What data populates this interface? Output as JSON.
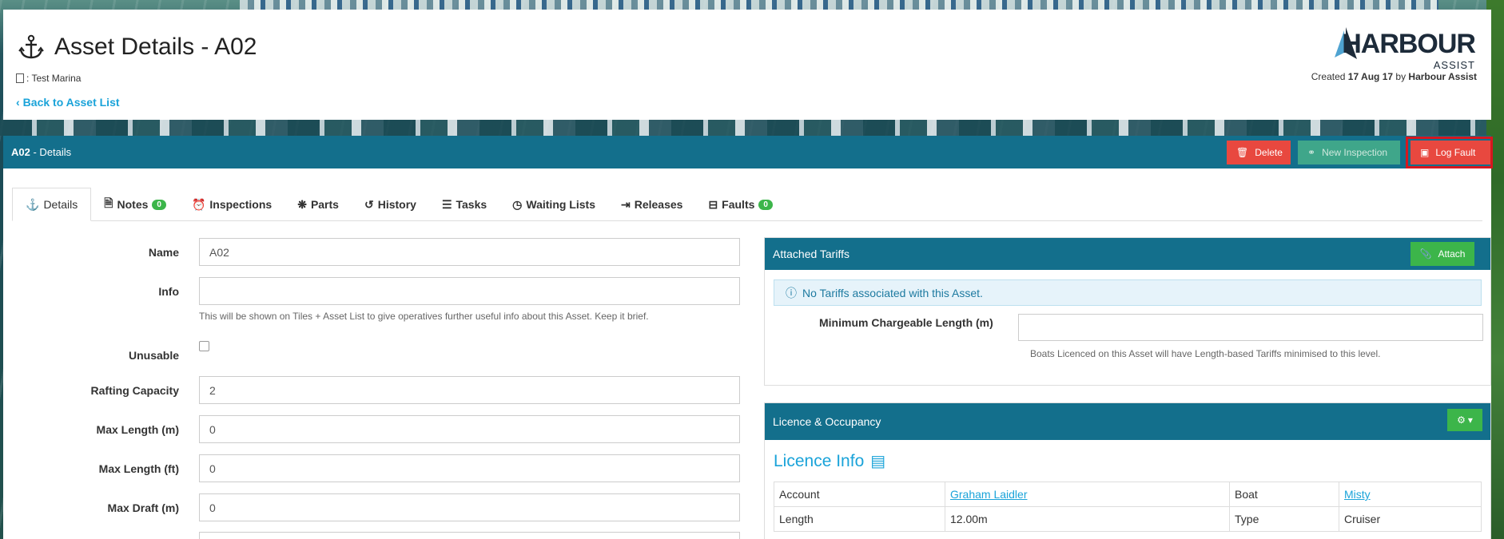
{
  "header": {
    "title": "Asset Details - A02",
    "marina": ": Test Marina",
    "back_link": "Back to Asset List",
    "logo_main": "HARBOUR",
    "logo_sub": "ASSIST",
    "created_prefix": "Created",
    "created_date": "17 Aug 17",
    "created_by_prefix": "by",
    "created_by": "Harbour Assist"
  },
  "bar": {
    "asset_code": "A02",
    "suffix": "- Details",
    "delete_label": "Delete",
    "new_inspection_label": "New Inspection",
    "log_fault_label": "Log Fault"
  },
  "tabs": [
    {
      "label": "Details",
      "icon": "anchor-icon"
    },
    {
      "label": "Notes",
      "icon": "document-icon",
      "badge": "0"
    },
    {
      "label": "Inspections",
      "icon": "alarm-clock-icon"
    },
    {
      "label": "Parts",
      "icon": "puzzle-icon"
    },
    {
      "label": "History",
      "icon": "history-icon"
    },
    {
      "label": "Tasks",
      "icon": "task-list-icon"
    },
    {
      "label": "Waiting Lists",
      "icon": "clock-icon"
    },
    {
      "label": "Releases",
      "icon": "sign-out-icon"
    },
    {
      "label": "Faults",
      "icon": "toolbox-icon",
      "badge": "0"
    }
  ],
  "form": {
    "name_label": "Name",
    "name_value": "A02",
    "info_label": "Info",
    "info_value": "",
    "info_help": "This will be shown on Tiles + Asset List to give operatives further useful info about this Asset. Keep it brief.",
    "unusable_label": "Unusable",
    "rafting_label": "Rafting Capacity",
    "rafting_value": "2",
    "max_length_m_label": "Max Length (m)",
    "max_length_m_value": "0",
    "max_length_ft_label": "Max Length (ft)",
    "max_length_ft_value": "0",
    "max_draft_label": "Max Draft (m)",
    "max_draft_value": "0"
  },
  "tariffs": {
    "title": "Attached Tariffs",
    "attach_label": "Attach",
    "no_tariffs": "No Tariffs associated with this Asset.",
    "min_length_label": "Minimum Chargeable Length (m)",
    "min_length_value": "",
    "min_length_help": "Boats Licenced on this Asset will have Length-based Tariffs minimised to this level."
  },
  "licence": {
    "title": "Licence & Occupancy",
    "info_title": "Licence Info",
    "rows": [
      {
        "k1": "Account",
        "v1": "Graham Laidler",
        "k2": "Boat",
        "v2": "Misty"
      },
      {
        "k1": "Length",
        "v1": "12.00m",
        "k2": "Type",
        "v2": "Cruiser"
      }
    ]
  },
  "colors": {
    "bar_blue": "#136f8c",
    "danger_red": "#e8483f",
    "success_green": "#3cb54a",
    "link_blue": "#1aa3d9",
    "highlight_red": "#d6171f"
  }
}
